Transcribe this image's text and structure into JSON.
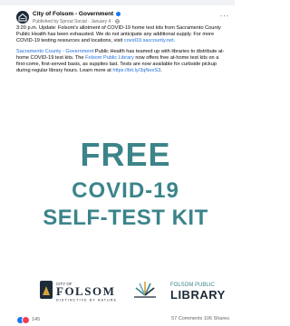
{
  "post": {
    "page_name": "City of Folsom - Government",
    "meta": "Published by Sprout Social · January 4 ·",
    "paragraph1": "3:20 p.m. Update: Folsom's allotment of COVID-19 home test kits from Sacramento County Public Health has been exhausted. We do not anticipate any additional supply. For more COVID-19 testing resources and locations, visit ",
    "paragraph1_link": "covid19.saccounty.net.",
    "paragraph2_link_a": "Sacramento County - Government",
    "paragraph2_part_a": " Public Health has teamed up with libraries to distribute at-home COVID-19 test kits. The ",
    "paragraph2_link_b": "Folsom Public Library",
    "paragraph2_part_b": " now offers free at-home test kits on a first-come, first-served basis, as supplies last. Tests are now available for curbside pickup during regular library hours. Learn more at ",
    "paragraph2_link_c": "https://bit.ly/3qNexS3",
    "paragraph2_end": "."
  },
  "image": {
    "line1": "FREE",
    "line2": "COVID-19",
    "line3": "SELF-TEST KIT",
    "logo_left_small": "CITY OF",
    "logo_left_big": "FOLSOM",
    "logo_left_tagline": "DISTINCTIVE BY NATURE",
    "logo_right_small": "FOLSOM PUBLIC",
    "logo_right_big": "LIBRARY"
  },
  "footer": {
    "reaction_count": "145",
    "stats": "57 Comments  106 Shares"
  },
  "colors": {
    "teal": "#3b848a",
    "link": "#216fdb",
    "navy": "#1c2b39",
    "like": "#1877f2",
    "love": "#f33e58"
  },
  "icons": [
    "house-logo-icon",
    "more-options-icon",
    "like-reaction-icon",
    "love-reaction-icon",
    "book-fan-icon"
  ]
}
